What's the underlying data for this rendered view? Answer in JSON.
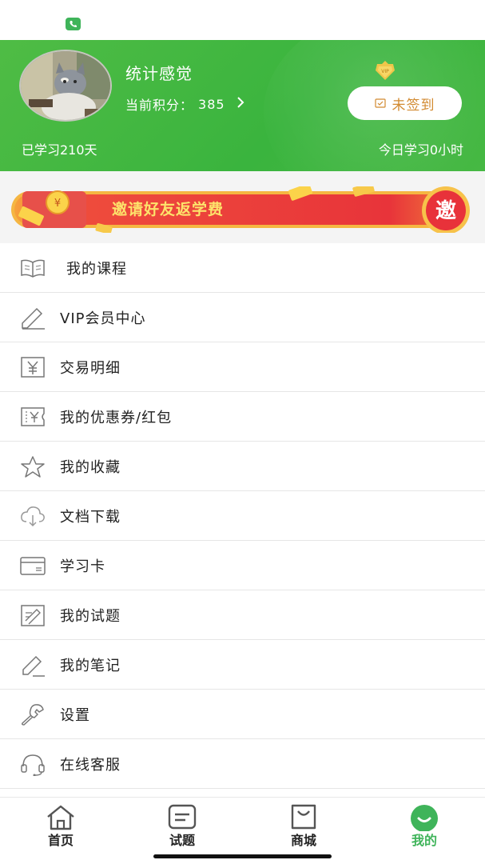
{
  "profile": {
    "username": "统计感觉",
    "points_label": "当前积分：",
    "points_value": "385",
    "checkin_label": "未签到",
    "studied_days": "已学习210天",
    "today_study": "今日学习0小时",
    "vip_badge_text": "VIP"
  },
  "banner": {
    "text": "邀请好友返学费",
    "badge": "邀",
    "coin_symbol": "¥"
  },
  "menu": {
    "items": [
      {
        "label": "我的课程",
        "icon": "book-icon"
      },
      {
        "label": "VIP会员中心",
        "icon": "pen-icon"
      },
      {
        "label": "交易明细",
        "icon": "yen-bill-icon"
      },
      {
        "label": "我的优惠券/红包",
        "icon": "coupon-icon"
      },
      {
        "label": "我的收藏",
        "icon": "star-icon"
      },
      {
        "label": "文档下载",
        "icon": "cloud-download-icon"
      },
      {
        "label": "学习卡",
        "icon": "card-icon"
      },
      {
        "label": "我的试题",
        "icon": "exam-icon"
      },
      {
        "label": "我的笔记",
        "icon": "note-pen-icon"
      },
      {
        "label": "设置",
        "icon": "wrench-icon"
      },
      {
        "label": "在线客服",
        "icon": "headset-icon"
      }
    ]
  },
  "tabs": [
    {
      "label": "首页",
      "icon": "home-icon"
    },
    {
      "label": "试题",
      "icon": "exam-tab-icon"
    },
    {
      "label": "商城",
      "icon": "shop-bag-icon"
    },
    {
      "label": "我的",
      "icon": "profile-smile-icon",
      "active": true
    }
  ],
  "colors": {
    "brand_green": "#3fb45a",
    "checkin_text": "#d28a30",
    "banner_red": "#e8343a",
    "banner_yellow": "#fde36b"
  }
}
